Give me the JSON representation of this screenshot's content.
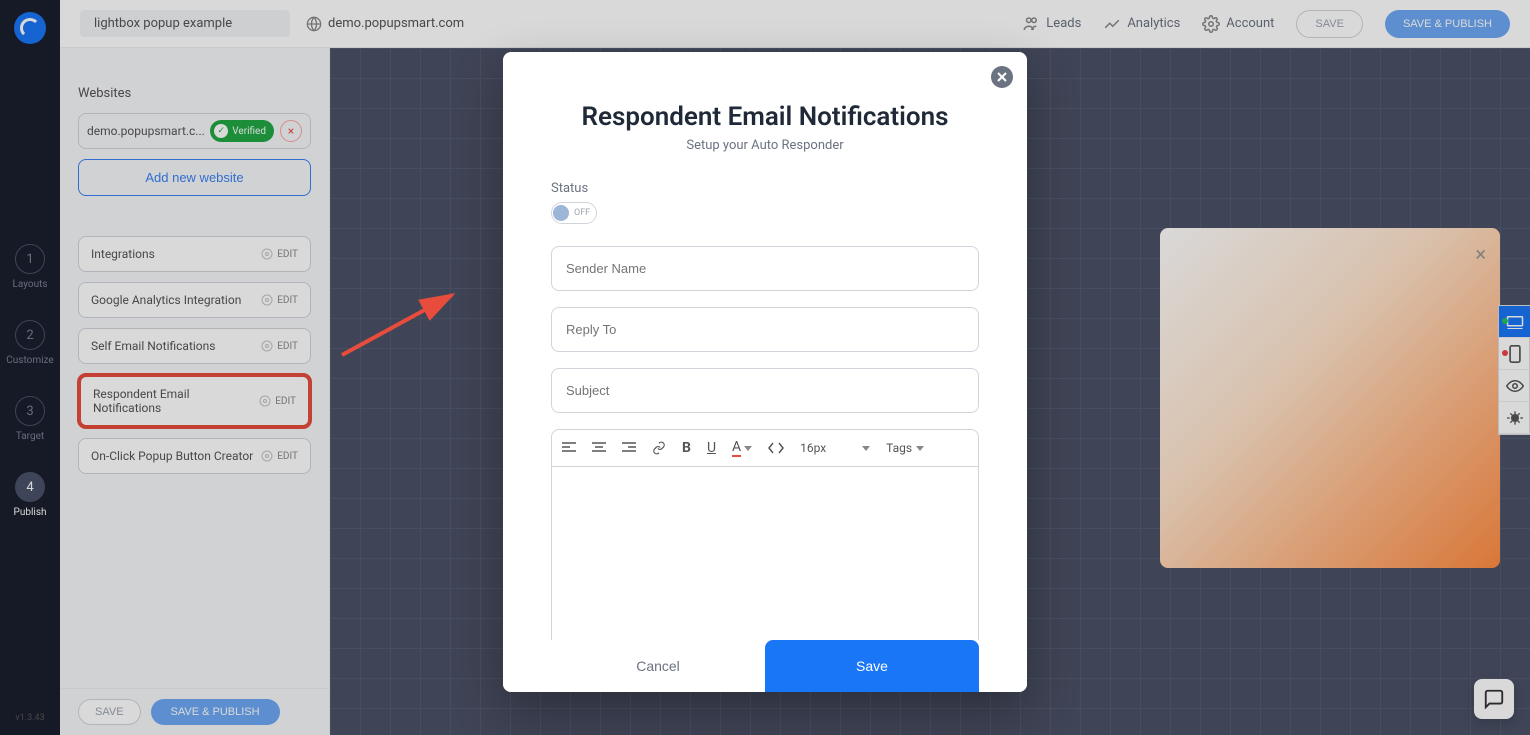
{
  "topbar": {
    "campaign_name": "lightbox popup example",
    "domain": "demo.popupsmart.com",
    "links": {
      "leads": "Leads",
      "analytics": "Analytics",
      "account": "Account"
    },
    "save": "SAVE",
    "save_publish": "SAVE & PUBLISH"
  },
  "nav": {
    "steps": [
      {
        "num": "1",
        "label": "Layouts"
      },
      {
        "num": "2",
        "label": "Customize"
      },
      {
        "num": "3",
        "label": "Target"
      },
      {
        "num": "4",
        "label": "Publish"
      }
    ],
    "version": "v1.3.43"
  },
  "panel": {
    "websites_label": "Websites",
    "website_domain": "demo.popupsmart.c...",
    "verified": "Verified",
    "add_website": "Add new website",
    "items": [
      {
        "label": "Integrations",
        "edit": "EDIT"
      },
      {
        "label": "Google Analytics Integration",
        "edit": "EDIT"
      },
      {
        "label": "Self Email Notifications",
        "edit": "EDIT"
      },
      {
        "label": "Respondent Email Notifications",
        "edit": "EDIT",
        "highlighted": true
      },
      {
        "label": "On-Click Popup Button Creator",
        "edit": "EDIT"
      }
    ],
    "save": "SAVE",
    "save_publish": "SAVE & PUBLISH"
  },
  "modal": {
    "title": "Respondent Email Notifications",
    "subtitle": "Setup your Auto Responder",
    "status_label": "Status",
    "toggle": "OFF",
    "inputs": {
      "sender": "Sender Name",
      "reply": "Reply To",
      "subject": "Subject"
    },
    "toolbar": {
      "fontsize": "16px",
      "tags": "Tags"
    },
    "cancel": "Cancel",
    "save": "Save"
  },
  "colors": {
    "primary": "#1976f7",
    "danger": "#e74c3c"
  }
}
